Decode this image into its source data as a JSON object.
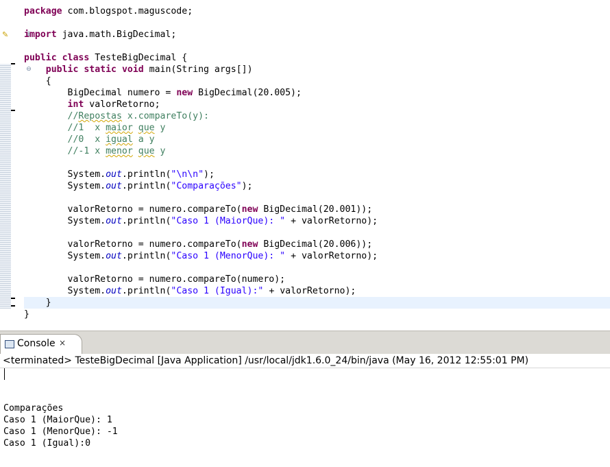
{
  "editor": {
    "lines": [
      [
        {
          "t": "package",
          "c": "kw"
        },
        {
          "t": " com.blogspot.maguscode;"
        }
      ],
      [],
      [
        {
          "t": "import",
          "c": "kw"
        },
        {
          "t": " java.math.BigDecimal;"
        }
      ],
      [],
      [
        {
          "t": "public",
          "c": "kw"
        },
        {
          "t": " "
        },
        {
          "t": "class",
          "c": "kw"
        },
        {
          "t": " TesteBigDecimal {"
        }
      ],
      [
        {
          "t": "    "
        },
        {
          "t": "public",
          "c": "kw"
        },
        {
          "t": " "
        },
        {
          "t": "static",
          "c": "kw"
        },
        {
          "t": " "
        },
        {
          "t": "void",
          "c": "kw"
        },
        {
          "t": " main(String args[])"
        }
      ],
      [
        {
          "t": "    {"
        }
      ],
      [
        {
          "t": "        BigDecimal numero = "
        },
        {
          "t": "new",
          "c": "kw"
        },
        {
          "t": " BigDecimal(20.005);"
        }
      ],
      [
        {
          "t": "        "
        },
        {
          "t": "int",
          "c": "kw"
        },
        {
          "t": " valorRetorno;"
        }
      ],
      [
        {
          "t": "        //",
          "c": "cmt"
        },
        {
          "t": "Repostas",
          "c": "cmt squig"
        },
        {
          "t": " x.compareTo(y):",
          "c": "cmt"
        }
      ],
      [
        {
          "t": "        //1  x ",
          "c": "cmt"
        },
        {
          "t": "maior",
          "c": "cmt squig"
        },
        {
          "t": " ",
          "c": "cmt"
        },
        {
          "t": "que",
          "c": "cmt squig"
        },
        {
          "t": " y",
          "c": "cmt"
        }
      ],
      [
        {
          "t": "        //0  x ",
          "c": "cmt"
        },
        {
          "t": "igual",
          "c": "cmt squig"
        },
        {
          "t": " a y",
          "c": "cmt"
        }
      ],
      [
        {
          "t": "        //-1 x ",
          "c": "cmt"
        },
        {
          "t": "menor",
          "c": "cmt squig"
        },
        {
          "t": " ",
          "c": "cmt"
        },
        {
          "t": "que",
          "c": "cmt squig"
        },
        {
          "t": " y",
          "c": "cmt"
        }
      ],
      [],
      [
        {
          "t": "        System."
        },
        {
          "t": "out",
          "c": "fld"
        },
        {
          "t": ".println("
        },
        {
          "t": "\"\\n\\n\"",
          "c": "str"
        },
        {
          "t": ");"
        }
      ],
      [
        {
          "t": "        System."
        },
        {
          "t": "out",
          "c": "fld"
        },
        {
          "t": ".println("
        },
        {
          "t": "\"Comparações\"",
          "c": "str"
        },
        {
          "t": ");"
        }
      ],
      [],
      [
        {
          "t": "        valorRetorno = numero.compareTo("
        },
        {
          "t": "new",
          "c": "kw"
        },
        {
          "t": " BigDecimal(20.001));"
        }
      ],
      [
        {
          "t": "        System."
        },
        {
          "t": "out",
          "c": "fld"
        },
        {
          "t": ".println("
        },
        {
          "t": "\"Caso 1 (MaiorQue): \"",
          "c": "str"
        },
        {
          "t": " + valorRetorno);"
        }
      ],
      [],
      [
        {
          "t": "        valorRetorno = numero.compareTo("
        },
        {
          "t": "new",
          "c": "kw"
        },
        {
          "t": " BigDecimal(20.006));"
        }
      ],
      [
        {
          "t": "        System."
        },
        {
          "t": "out",
          "c": "fld"
        },
        {
          "t": ".println("
        },
        {
          "t": "\"Caso 1 (MenorQue): \"",
          "c": "str"
        },
        {
          "t": " + valorRetorno);"
        }
      ],
      [],
      [
        {
          "t": "        valorRetorno = numero.compareTo(numero);"
        }
      ],
      [
        {
          "t": "        System."
        },
        {
          "t": "out",
          "c": "fld"
        },
        {
          "t": ".println("
        },
        {
          "t": "\"Caso 1 (Igual):\"",
          "c": "str"
        },
        {
          "t": " + valorRetorno);"
        }
      ],
      [
        {
          "t": "    }"
        }
      ],
      [
        {
          "t": "}"
        }
      ]
    ],
    "current_line_index": 25
  },
  "console": {
    "tab_label": "Console",
    "status": "<terminated> TesteBigDecimal [Java Application] /usr/local/jdk1.6.0_24/bin/java (May 16, 2012 12:55:01 PM)",
    "output": [
      "Comparações",
      "Caso 1 (MaiorQue): 1",
      "Caso 1 (MenorQue): -1",
      "Caso 1 (Igual):0"
    ]
  },
  "icons": {
    "close": "×",
    "fold": "⊖",
    "expand": "⊕",
    "bulb": "✎"
  }
}
